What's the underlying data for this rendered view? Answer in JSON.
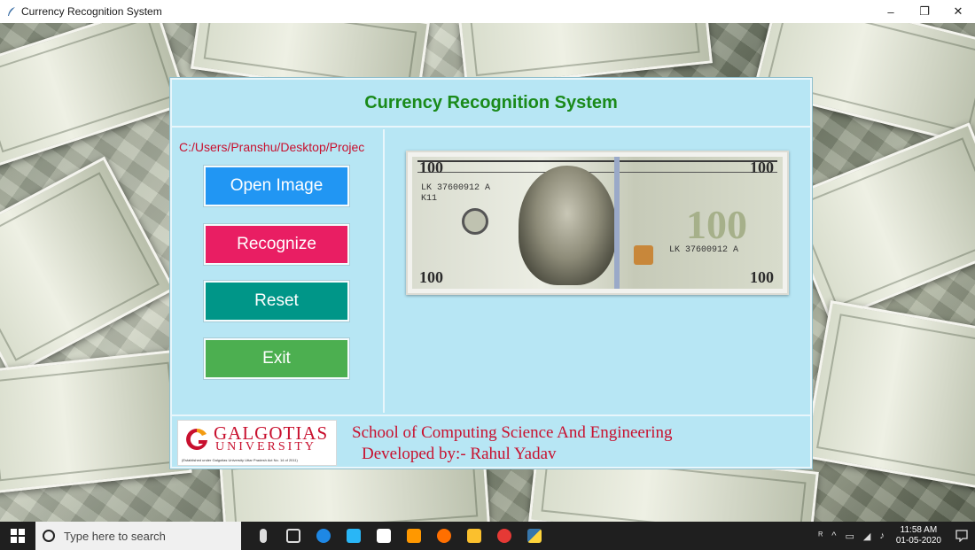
{
  "window": {
    "title": "Currency Recognition System",
    "controls": {
      "minimize": "–",
      "maximize": "❐",
      "close": "✕"
    }
  },
  "app": {
    "header_title": "Currency Recognition System",
    "file_path": "C:/Users/Pranshu/Desktop/Projec",
    "buttons": {
      "open_image": "Open Image",
      "recognize": "Recognize",
      "reset": "Reset",
      "exit": "Exit"
    },
    "button_colors": {
      "open_image": "#2196f3",
      "recognize": "#e91e63",
      "reset": "#009688",
      "exit": "#4caf50"
    },
    "preview": {
      "icon": "banknote-100-dollar",
      "serial": "LK 37600912 A",
      "row": "K11",
      "denomination": "100"
    },
    "footer": {
      "logo_name": "GALGOTIAS",
      "logo_sub": "UNIVERSITY",
      "logo_est": "(Established under Galgotias University Uttar Pradesh Act No. 14 of 2011)",
      "school": "School of Computing Science And Engineering",
      "developer": "Developed by:- Rahul Yadav"
    },
    "accent_title_color": "#1a8a1a",
    "text_red": "#c8102e",
    "panel_bg": "#b7e6f4"
  },
  "taskbar": {
    "search_placeholder": "Type here to search",
    "pinned_icons": [
      "microphone-icon",
      "task-view-icon",
      "edge-icon",
      "mail-icon",
      "store-icon",
      "sublime-icon",
      "firefox-icon",
      "file-explorer-icon",
      "opera-icon",
      "python-icon"
    ],
    "time": "11:58 AM",
    "date": "01-05-2020"
  }
}
